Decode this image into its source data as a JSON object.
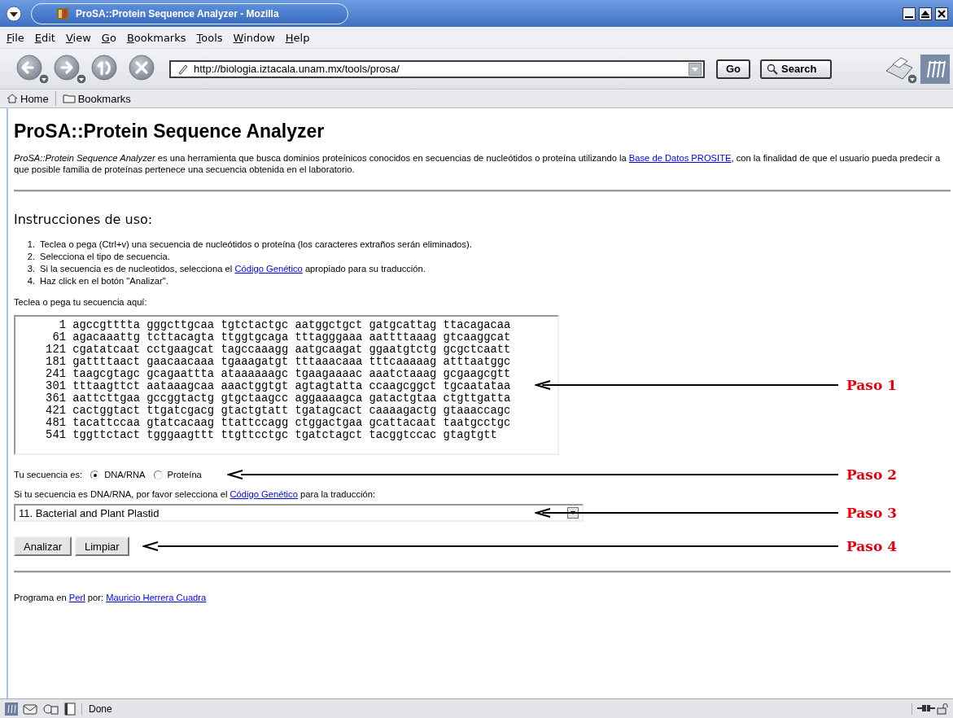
{
  "window": {
    "title": "ProSA::Protein Sequence Analyzer - Mozilla"
  },
  "menu": [
    "File",
    "Edit",
    "View",
    "Go",
    "Bookmarks",
    "Tools",
    "Window",
    "Help"
  ],
  "toolbar": {
    "url": "http://biologia.iztacala.unam.mx/tools/prosa/",
    "go": "Go",
    "search": "Search"
  },
  "personal_bar": [
    "Home",
    "Bookmarks"
  ],
  "page": {
    "title": "ProSA::Protein Sequence Analyzer",
    "intro": {
      "before": "*ProSA::Protein Sequence Analyzer* es una herramienta que busca dominios proteínicos conocidos en secuencias de nucleótidos o proteína utilizando la ",
      "link": "Base de Datos PROSITE",
      "after": ", con la finalidad de que el usuario pueda predecir a que posible familia de proteínas pertenece una secuencia obtenida en el laboratorio."
    },
    "instructions_title": "Instrucciones de uso:",
    "steps": [
      {
        "number": "1.",
        "before": "Teclea o pega (Ctrl+v) una secuencia de nucleótidos o proteína (los caracteres extraños serán eliminados)."
      },
      {
        "number": "2.",
        "before": "Selecciona el tipo de secuencia."
      },
      {
        "number": "3.",
        "before": "Si la secuencia es de nucleotidos, selecciona el ",
        "link": "Código Genético",
        "after": " apropiado para su traducción."
      },
      {
        "number": "4.",
        "before": "Haz click en el botón \"Analizar\"."
      }
    ],
    "sequence_label": "Teclea o pega tu secuencia aquí:",
    "sequence_lines": [
      "      1 agccgtttta gggcttgcaa tgtctactgc aatggctgct gatgcattag ttacagacaa",
      "     61 agacaaattg tcttacagta ttggtgcaga tttagggaaa aattttaaag gtcaaggcat",
      "    121 cgatatcaat cctgaagcat tagccaaagg aatgcaagat ggaatgtctg gcgctcaatt",
      "    181 gattttaact gaacaacaaa tgaaagatgt tttaaacaaa tttcaaaaag atttaatggc",
      "    241 taagcgtagc gcagaattta ataaaaaagc tgaagaaaac aaatctaaag gcgaagcgtt",
      "    301 tttaagttct aataaagcaa aaactggtgt agtagtatta ccaagcggct tgcaatataa",
      "    361 aattcttgaa gccggtactg gtgctaagcc aggaaaagca gatactgtaa ctgttgatta",
      "    421 cactggtact ttgatcgacg gtactgtatt tgatagcact caaaagactg gtaaaccagc",
      "    481 tacattccaa gtatcacaag ttattccagg ctggactgaa gcattacaat taatgcctgc",
      "    541 tggttctact tgggaagttt ttgttcctgc tgatctagct tacggtccac gtagtgtt"
    ],
    "sequence_type_label": "Tu secuencia es:",
    "sequence_types": [
      {
        "label": "DNA/RNA",
        "selected": true
      },
      {
        "label": "Proteína",
        "selected": false
      }
    ],
    "code_label": {
      "before": "Si tu secuencia es DNA/RNA, por favor selecciona el ",
      "link": "Código Genético",
      "after": " para la traducción:"
    },
    "genetic_code": "11. Bacterial and Plant Plastid",
    "buttons": [
      "Analizar",
      "Limpiar"
    ],
    "footer": {
      "before": "Programa en ",
      "link1": "Perl",
      "middle": " por: ",
      "link2": "Mauricio Herrera Cuadra"
    }
  },
  "annotations": [
    "Paso 1",
    "Paso 2",
    "Paso 3",
    "Paso 4"
  ],
  "status_bar": {
    "text": "Done"
  }
}
